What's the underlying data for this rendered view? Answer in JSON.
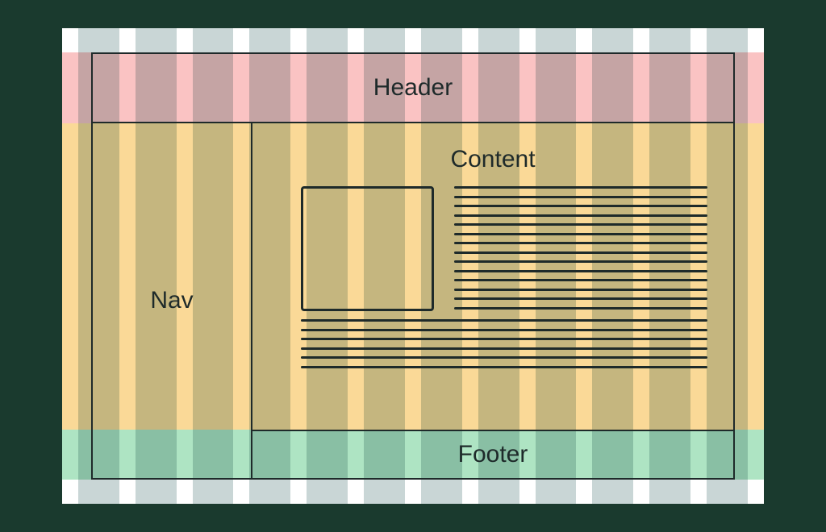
{
  "regions": {
    "header": {
      "label": "Header"
    },
    "nav": {
      "label": "Nav"
    },
    "content": {
      "label": "Content"
    },
    "footer": {
      "label": "Footer"
    }
  },
  "grid": {
    "columns": 12
  }
}
